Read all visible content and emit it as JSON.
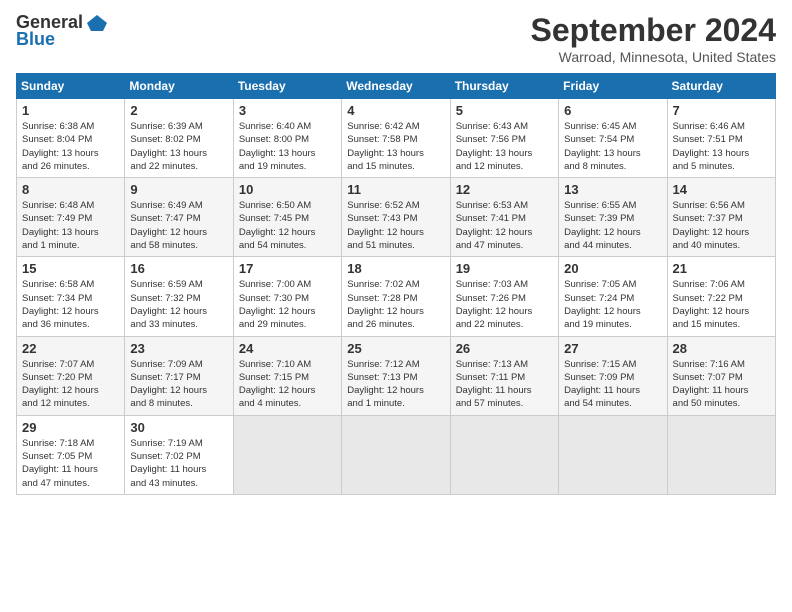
{
  "header": {
    "logo_general": "General",
    "logo_blue": "Blue",
    "title": "September 2024",
    "location": "Warroad, Minnesota, United States"
  },
  "days_of_week": [
    "Sunday",
    "Monday",
    "Tuesday",
    "Wednesday",
    "Thursday",
    "Friday",
    "Saturday"
  ],
  "weeks": [
    [
      {
        "day": "1",
        "info": "Sunrise: 6:38 AM\nSunset: 8:04 PM\nDaylight: 13 hours\nand 26 minutes."
      },
      {
        "day": "2",
        "info": "Sunrise: 6:39 AM\nSunset: 8:02 PM\nDaylight: 13 hours\nand 22 minutes."
      },
      {
        "day": "3",
        "info": "Sunrise: 6:40 AM\nSunset: 8:00 PM\nDaylight: 13 hours\nand 19 minutes."
      },
      {
        "day": "4",
        "info": "Sunrise: 6:42 AM\nSunset: 7:58 PM\nDaylight: 13 hours\nand 15 minutes."
      },
      {
        "day": "5",
        "info": "Sunrise: 6:43 AM\nSunset: 7:56 PM\nDaylight: 13 hours\nand 12 minutes."
      },
      {
        "day": "6",
        "info": "Sunrise: 6:45 AM\nSunset: 7:54 PM\nDaylight: 13 hours\nand 8 minutes."
      },
      {
        "day": "7",
        "info": "Sunrise: 6:46 AM\nSunset: 7:51 PM\nDaylight: 13 hours\nand 5 minutes."
      }
    ],
    [
      {
        "day": "8",
        "info": "Sunrise: 6:48 AM\nSunset: 7:49 PM\nDaylight: 13 hours\nand 1 minute."
      },
      {
        "day": "9",
        "info": "Sunrise: 6:49 AM\nSunset: 7:47 PM\nDaylight: 12 hours\nand 58 minutes."
      },
      {
        "day": "10",
        "info": "Sunrise: 6:50 AM\nSunset: 7:45 PM\nDaylight: 12 hours\nand 54 minutes."
      },
      {
        "day": "11",
        "info": "Sunrise: 6:52 AM\nSunset: 7:43 PM\nDaylight: 12 hours\nand 51 minutes."
      },
      {
        "day": "12",
        "info": "Sunrise: 6:53 AM\nSunset: 7:41 PM\nDaylight: 12 hours\nand 47 minutes."
      },
      {
        "day": "13",
        "info": "Sunrise: 6:55 AM\nSunset: 7:39 PM\nDaylight: 12 hours\nand 44 minutes."
      },
      {
        "day": "14",
        "info": "Sunrise: 6:56 AM\nSunset: 7:37 PM\nDaylight: 12 hours\nand 40 minutes."
      }
    ],
    [
      {
        "day": "15",
        "info": "Sunrise: 6:58 AM\nSunset: 7:34 PM\nDaylight: 12 hours\nand 36 minutes."
      },
      {
        "day": "16",
        "info": "Sunrise: 6:59 AM\nSunset: 7:32 PM\nDaylight: 12 hours\nand 33 minutes."
      },
      {
        "day": "17",
        "info": "Sunrise: 7:00 AM\nSunset: 7:30 PM\nDaylight: 12 hours\nand 29 minutes."
      },
      {
        "day": "18",
        "info": "Sunrise: 7:02 AM\nSunset: 7:28 PM\nDaylight: 12 hours\nand 26 minutes."
      },
      {
        "day": "19",
        "info": "Sunrise: 7:03 AM\nSunset: 7:26 PM\nDaylight: 12 hours\nand 22 minutes."
      },
      {
        "day": "20",
        "info": "Sunrise: 7:05 AM\nSunset: 7:24 PM\nDaylight: 12 hours\nand 19 minutes."
      },
      {
        "day": "21",
        "info": "Sunrise: 7:06 AM\nSunset: 7:22 PM\nDaylight: 12 hours\nand 15 minutes."
      }
    ],
    [
      {
        "day": "22",
        "info": "Sunrise: 7:07 AM\nSunset: 7:20 PM\nDaylight: 12 hours\nand 12 minutes."
      },
      {
        "day": "23",
        "info": "Sunrise: 7:09 AM\nSunset: 7:17 PM\nDaylight: 12 hours\nand 8 minutes."
      },
      {
        "day": "24",
        "info": "Sunrise: 7:10 AM\nSunset: 7:15 PM\nDaylight: 12 hours\nand 4 minutes."
      },
      {
        "day": "25",
        "info": "Sunrise: 7:12 AM\nSunset: 7:13 PM\nDaylight: 12 hours\nand 1 minute."
      },
      {
        "day": "26",
        "info": "Sunrise: 7:13 AM\nSunset: 7:11 PM\nDaylight: 11 hours\nand 57 minutes."
      },
      {
        "day": "27",
        "info": "Sunrise: 7:15 AM\nSunset: 7:09 PM\nDaylight: 11 hours\nand 54 minutes."
      },
      {
        "day": "28",
        "info": "Sunrise: 7:16 AM\nSunset: 7:07 PM\nDaylight: 11 hours\nand 50 minutes."
      }
    ],
    [
      {
        "day": "29",
        "info": "Sunrise: 7:18 AM\nSunset: 7:05 PM\nDaylight: 11 hours\nand 47 minutes."
      },
      {
        "day": "30",
        "info": "Sunrise: 7:19 AM\nSunset: 7:02 PM\nDaylight: 11 hours\nand 43 minutes."
      },
      {
        "day": "",
        "info": ""
      },
      {
        "day": "",
        "info": ""
      },
      {
        "day": "",
        "info": ""
      },
      {
        "day": "",
        "info": ""
      },
      {
        "day": "",
        "info": ""
      }
    ]
  ]
}
